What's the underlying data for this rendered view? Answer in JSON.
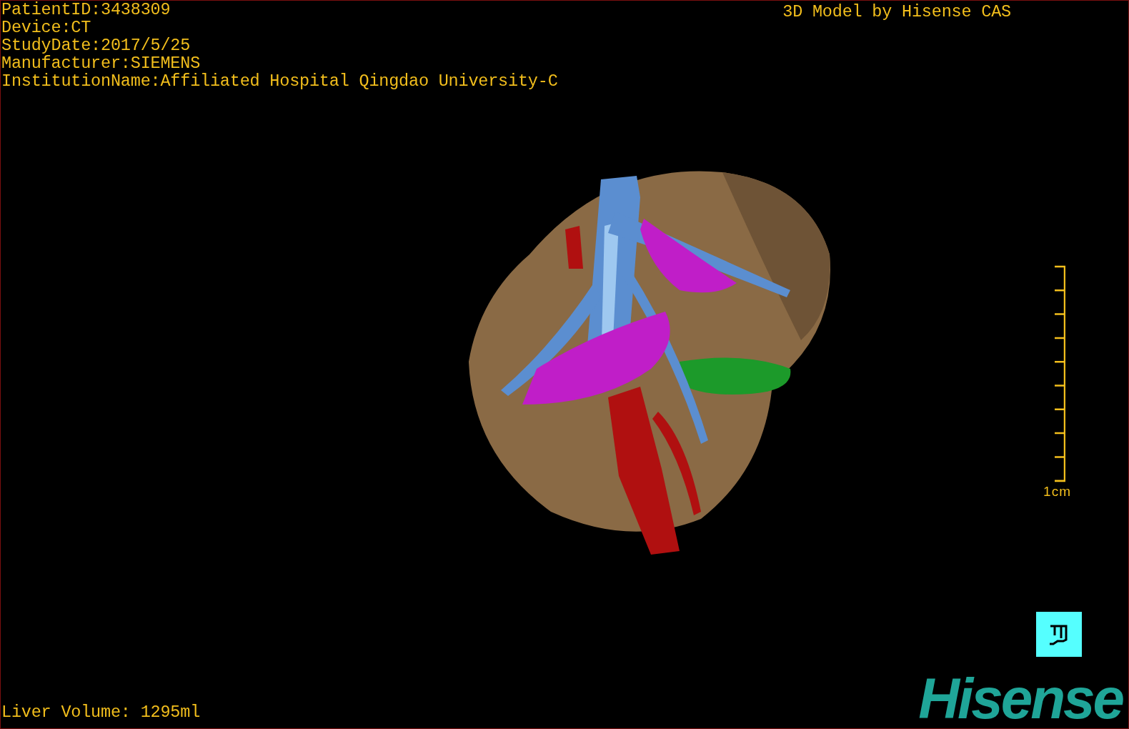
{
  "study_info": [
    "PatientID:3438309",
    "Device:CT",
    "StudyDate:2017/5/25",
    "Manufacturer:SIEMENS",
    "InstitutionName:Affiliated Hospital Qingdao University-C"
  ],
  "title": "3D Model by Hisense CAS",
  "scale_bar": {
    "label": "1cm"
  },
  "liver_volume": "Liver Volume: 1295ml",
  "logo": "Hisense"
}
